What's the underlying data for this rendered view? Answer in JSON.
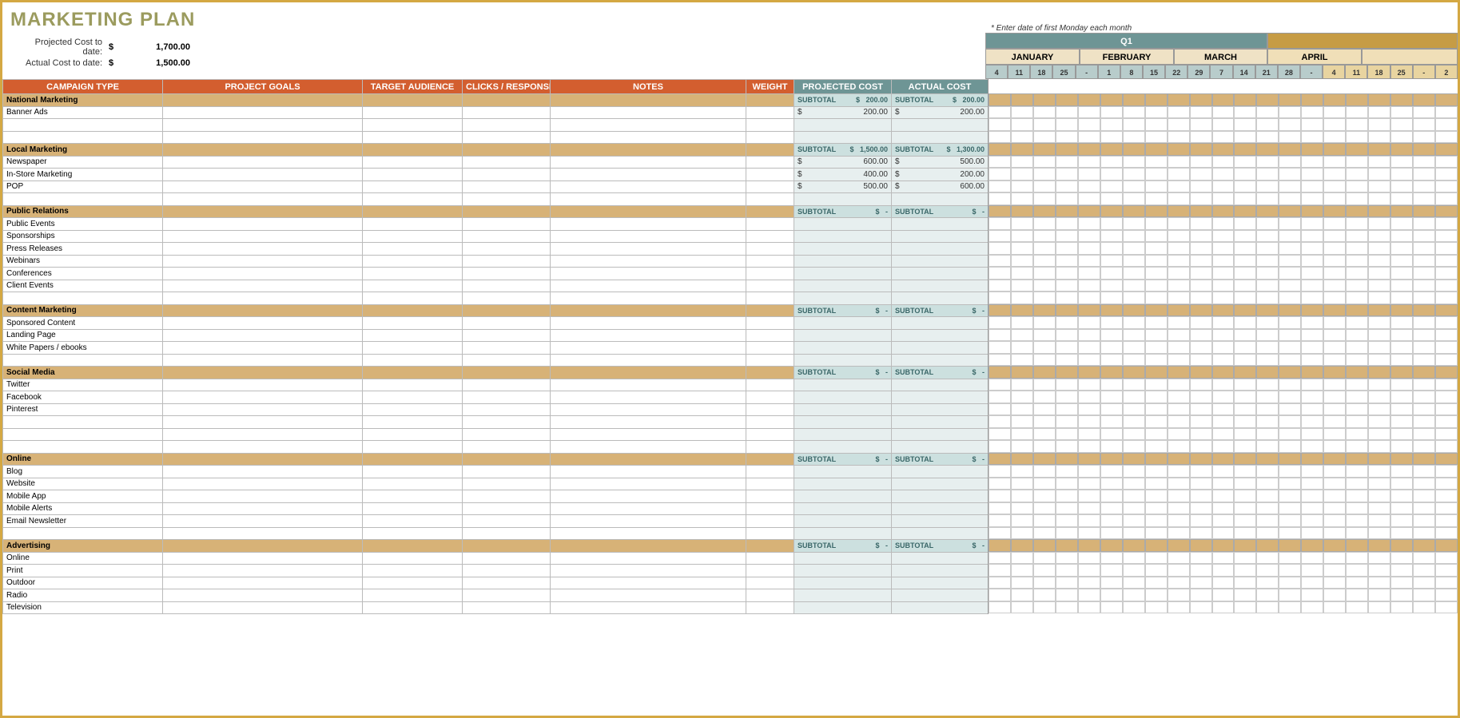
{
  "title": "MARKETING PLAN",
  "summary": {
    "projected_label": "Projected Cost to date:",
    "actual_label": "Actual Cost to date:",
    "currency": "$",
    "projected_value": "1,700.00",
    "actual_value": "1,500.00"
  },
  "date_hint": "* Enter date of first Monday each month",
  "headers": {
    "campaign": "CAMPAIGN TYPE",
    "goals": "PROJECT GOALS",
    "audience": "TARGET AUDIENCE",
    "clicks": "CLICKS / RESPONSE",
    "notes": "NOTES",
    "weight": "WEIGHT",
    "projected": "PROJECTED COST",
    "actual": "ACTUAL COST"
  },
  "calendar": {
    "q1": "Q1",
    "months": [
      "JANUARY",
      "FEBRUARY",
      "MARCH",
      "APRIL"
    ],
    "days": [
      "4",
      "11",
      "18",
      "25",
      "-",
      "1",
      "8",
      "15",
      "22",
      "29",
      "7",
      "14",
      "21",
      "28",
      "-",
      "4",
      "11",
      "18",
      "25",
      "-",
      "2"
    ]
  },
  "subtotal_label": "SUBTOTAL",
  "currency": "$",
  "dash": "-",
  "sections": [
    {
      "name": "National Marketing",
      "proj_subtotal": "200.00",
      "actual_subtotal": "200.00",
      "rows": [
        {
          "name": "Banner Ads",
          "proj": "200.00",
          "actual": "200.00"
        }
      ],
      "blanks": 2
    },
    {
      "name": "Local Marketing",
      "proj_subtotal": "1,500.00",
      "actual_subtotal": "1,300.00",
      "rows": [
        {
          "name": "Newspaper",
          "proj": "600.00",
          "actual": "500.00"
        },
        {
          "name": "In-Store Marketing",
          "proj": "400.00",
          "actual": "200.00"
        },
        {
          "name": "POP",
          "proj": "500.00",
          "actual": "600.00"
        }
      ],
      "blanks": 1
    },
    {
      "name": "Public Relations",
      "proj_subtotal": "-",
      "actual_subtotal": "-",
      "rows": [
        {
          "name": "Public Events",
          "proj": "",
          "actual": ""
        },
        {
          "name": "Sponsorships",
          "proj": "",
          "actual": ""
        },
        {
          "name": "Press Releases",
          "proj": "",
          "actual": ""
        },
        {
          "name": "Webinars",
          "proj": "",
          "actual": ""
        },
        {
          "name": "Conferences",
          "proj": "",
          "actual": ""
        },
        {
          "name": "Client Events",
          "proj": "",
          "actual": ""
        }
      ],
      "blanks": 1
    },
    {
      "name": "Content Marketing",
      "proj_subtotal": "-",
      "actual_subtotal": "-",
      "rows": [
        {
          "name": "Sponsored Content",
          "proj": "",
          "actual": ""
        },
        {
          "name": "Landing Page",
          "proj": "",
          "actual": ""
        },
        {
          "name": "White Papers / ebooks",
          "proj": "",
          "actual": ""
        }
      ],
      "blanks": 1
    },
    {
      "name": "Social Media",
      "proj_subtotal": "-",
      "actual_subtotal": "-",
      "rows": [
        {
          "name": "Twitter",
          "proj": "",
          "actual": ""
        },
        {
          "name": "Facebook",
          "proj": "",
          "actual": ""
        },
        {
          "name": "Pinterest",
          "proj": "",
          "actual": ""
        }
      ],
      "blanks": 3
    },
    {
      "name": "Online",
      "proj_subtotal": "-",
      "actual_subtotal": "-",
      "rows": [
        {
          "name": "Blog",
          "proj": "",
          "actual": ""
        },
        {
          "name": "Website",
          "proj": "",
          "actual": ""
        },
        {
          "name": "Mobile App",
          "proj": "",
          "actual": ""
        },
        {
          "name": "Mobile Alerts",
          "proj": "",
          "actual": ""
        },
        {
          "name": "Email Newsletter",
          "proj": "",
          "actual": ""
        }
      ],
      "blanks": 1
    },
    {
      "name": "Advertising",
      "proj_subtotal": "-",
      "actual_subtotal": "-",
      "rows": [
        {
          "name": "Online",
          "proj": "",
          "actual": ""
        },
        {
          "name": "Print",
          "proj": "",
          "actual": ""
        },
        {
          "name": "Outdoor",
          "proj": "",
          "actual": ""
        },
        {
          "name": "Radio",
          "proj": "",
          "actual": ""
        },
        {
          "name": "Television",
          "proj": "",
          "actual": ""
        }
      ],
      "blanks": 0
    }
  ]
}
